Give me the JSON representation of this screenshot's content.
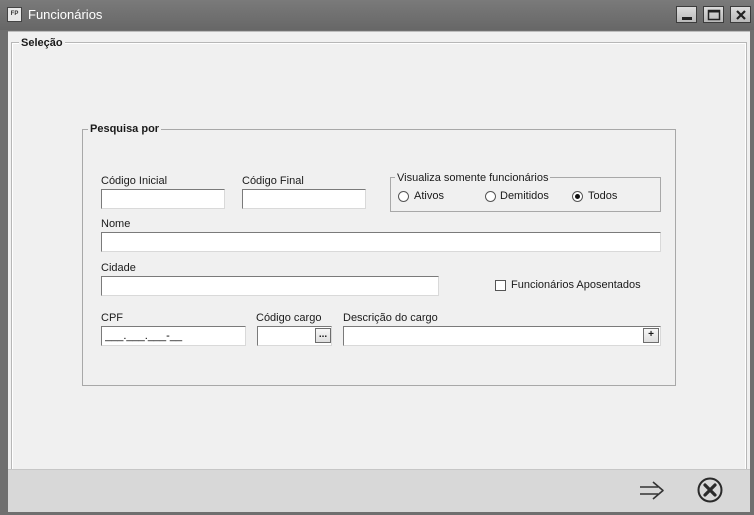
{
  "window": {
    "icon_text": "FP",
    "title": "Funcionários"
  },
  "selecao": {
    "legend": "Seleção"
  },
  "pesquisa": {
    "legend": "Pesquisa por",
    "codigo_inicial": {
      "label": "Código Inicial",
      "value": ""
    },
    "codigo_final": {
      "label": "Código Final",
      "value": ""
    },
    "visualiza": {
      "legend": "Visualiza somente funcionários",
      "options": [
        "Ativos",
        "Demitidos",
        "Todos"
      ],
      "selected": "Todos"
    },
    "nome": {
      "label": "Nome",
      "value": ""
    },
    "cidade": {
      "label": "Cidade",
      "value": ""
    },
    "aposentados": {
      "label": "Funcionários Aposentados",
      "checked": false
    },
    "cpf": {
      "label": "CPF",
      "value": "___.___.___-__"
    },
    "codigo_cargo": {
      "label": "Código cargo",
      "value": "",
      "button": "..."
    },
    "descricao_cargo": {
      "label": "Descrição do cargo",
      "value": "",
      "button": "+"
    }
  },
  "footer": {
    "confirm_icon": "arrow-right-icon",
    "close_icon": "close-circle-icon"
  }
}
